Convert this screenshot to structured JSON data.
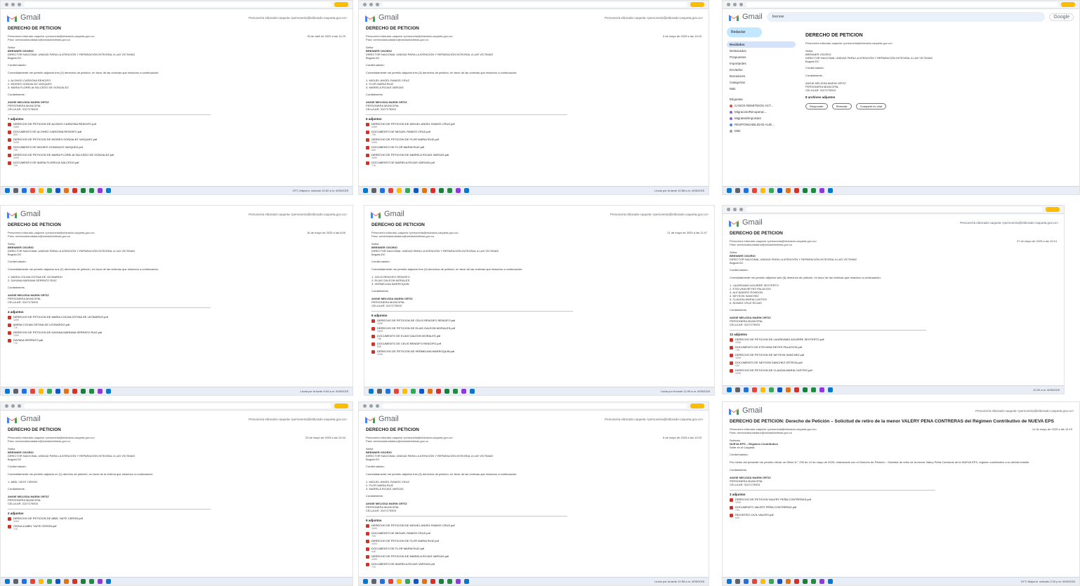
{
  "app": {
    "brand": "Gmail"
  },
  "account_line": "Personería eldorado-caqueta <personeria@eldorado-caqueta.gov.co>",
  "to_line": "Para: servicioalciudadano@unidadvictimas.gov.co",
  "closing": "Cordialmente,",
  "signer": [
    "ANGIE MELISSA MARIN ORTIZ",
    "PERSONERA MUNICIPAL",
    "CELULAR: 3107175903"
  ],
  "salutation": "Cordial saludo:",
  "recipient_block": [
    "Señor",
    "BRENNER OSORIO",
    "DIRECTOR NACIONAL UNIDAD PARA LA ATENCIÓN Y REPARACIÓN INTEGRAL A LAS VÍCTIMAS",
    "Bogotá DC"
  ],
  "tiles": [
    {
      "subject": "DERECHO DE PETICIÓN",
      "date": "30 de abril de 2025 a las 11:29",
      "intro": "Comedidamente me permito adjuntar tres (3) derechos de petición, en favor de las víctimas que relaciono a continuación:",
      "list": [
        "1. ALONSO CARDONA RENGIFO",
        "2. MOISES GONZALEZ VASQUEZ",
        "3. MARIA FLORELIA SALCEDO DE GONZALEZ"
      ],
      "attachments_title": "7 adjuntos",
      "attachments": [
        {
          "name": "DERECHO DE PETICION DE ALONSO CARDONA RENGIFO.pdf",
          "size": "348K"
        },
        {
          "name": "DOCUMENTO DE ALONSO CARDONA RENGIFO.pdf",
          "size": "83K"
        },
        {
          "name": "DERECHO DE PETICION DE MOISES GONZALEZ VASQUEZ.pdf",
          "size": "349K"
        },
        {
          "name": "DOCUMENTO DE MOISES GONZALEZ VASQUEZ.pdf",
          "size": "79K"
        },
        {
          "name": "DERECHO DE PETICION DE MARIA FLORELIA SALCEDO DE GONZALEZ.pdf",
          "size": "349K"
        },
        {
          "name": "DOCUMENTO DE MARIA FLORELIA SALCEDO.pdf",
          "size": "70K"
        }
      ],
      "taskbar_right": "19°C Mayorm. soleado  10:52 a.m. 6/05/2025"
    },
    {
      "subject": "DERECHO DE PETICIÓN",
      "date": "6 de mayo de 2025 a las 10:03",
      "intro": "Comedidamente me permito adjuntar tres (3) derechos de petición, en favor de las víctimas que relaciono a continuación:",
      "list": [
        "1. MIGUEL ANGEL RAMOS CRUZ",
        "2. FLOR MARIA RUIZ",
        "3. MARIELA ROJAS VARGAS"
      ],
      "attachments_title": "6 adjuntos",
      "attachments": [
        {
          "name": "DERECHO DE PETICION DE MIGUEL ANGEL RAMOS CRUZ.pdf",
          "size": "349K"
        },
        {
          "name": "DOCUMENTO DE MIGUEL RAMOS CRUZ.pdf",
          "size": "79K"
        },
        {
          "name": "DERECHO DE PETICION DE FLOR MARIA RUIZ.pdf",
          "size": "349K"
        },
        {
          "name": "DOCUMENTO DE FLOR MARIA RUIZ.pdf",
          "size": "64K"
        },
        {
          "name": "DERECHO DE PETICION DE MARIELA ROJAS VARGAS.pdf",
          "size": "349K"
        },
        {
          "name": "DOCUMENTO DE MARIELA ROJAS VARGAS.pdf",
          "size": "71K"
        }
      ],
      "taskbar_right": "Lluvia por la tarde  10:58 a.m. 6/05/2025"
    },
    {
      "subject": "DERECHO DE PETICIÓN",
      "search": "brenner",
      "sidebar": [
        {
          "label": "Recibidos",
          "count": "",
          "active": true
        },
        {
          "label": "Destacados",
          "count": ""
        },
        {
          "label": "Pospuestos",
          "count": ""
        },
        {
          "label": "Importantes",
          "count": ""
        },
        {
          "label": "Enviados",
          "count": ""
        },
        {
          "label": "Borradores",
          "count": ""
        },
        {
          "label": "Categorías",
          "count": ""
        },
        {
          "label": "Más",
          "count": ""
        }
      ],
      "labels_title": "Etiquetas",
      "labels": [
        {
          "name": "CASOS REMITIDOS ACT...",
          "color": "#e8453c"
        },
        {
          "name": "Migración/Recuperac...",
          "color": "#8e63ce"
        },
        {
          "name": "Migrated/Important",
          "color": "#8e63ce"
        },
        {
          "name": "RESPONSABILIDAD AUD...",
          "color": "#4a86e8"
        },
        {
          "name": "Más",
          "color": "#9aa0a6"
        }
      ],
      "attachments_title": "8 archivos adjuntos",
      "reply": [
        "Responder",
        "Reenviar",
        "Compartir en chat"
      ],
      "google": "Google"
    },
    {
      "subject": "DERECHO DE PETICIÓN",
      "date": "16 de mayo de 2025 a las 8:59",
      "intro": "Comedidamente me permito adjuntar dos (2) derechos de petición, en favor de las víctimas que relaciono a continuación:",
      "list": [
        "1. MARIA COLMA OSTINA DE LEONARDO",
        "2. DAYANA MARIANA SERRATO RUIZ"
      ],
      "attachments_title": "4 adjuntos",
      "attachments": [
        {
          "name": "DERECHO DE PETICION DE MARIA COLMA OSTINA DE LEONARDO.pdf",
          "size": "349K"
        },
        {
          "name": "MARIA COLMA OSTINA DE LEONARDO.pdf",
          "size": "71K"
        },
        {
          "name": "DERECHO DE PETICION DE DAYANA MARIANA SERRATO RUIZ.pdf",
          "size": "349K"
        },
        {
          "name": "DAYANA SERRATO.pdf",
          "size": "71K"
        }
      ],
      "taskbar_right": "Lluvia por la tarde  9:04 a.m. 6/05/2025"
    },
    {
      "subject": "DERECHO DE PETICIÓN",
      "date": "21 de mayo de 2025 a las 11:47",
      "intro": "Comedidamente me permito adjuntar tres (3) derechos de petición, en favor de las víctimas que relaciono a continuación:",
      "list": [
        "1. CELIS RENGIFO RENGIFO",
        "2. ELIAS GALEON MORALES",
        "3. HERMELINA MARROQUIN"
      ],
      "attachments_title": "6 adjuntos",
      "attachments": [
        {
          "name": "DERECHO DE PETICION DE CELIS RENGIFO RENGIFO.pdf",
          "size": "349K"
        },
        {
          "name": "DERECHO DE PETICION DE ELIAS GALEON MORALES.pdf",
          "size": "349K"
        },
        {
          "name": "DOCUMENTO DE ELIAS GALEON MORALES.pdf",
          "size": "79K"
        },
        {
          "name": "DOCUMENTO DE CELIS RENGIFO RENGIFO.pdf",
          "size": "83K"
        },
        {
          "name": "DERECHO DE PETICION DE HERMELINA MARROQUIN.pdf",
          "size": "349K"
        }
      ],
      "taskbar_right": "Lluvia por la tarde  11:59 a.m. 6/05/2025"
    },
    {
      "subject": "DERECHO DE PETICIÓN",
      "date": "27 de mayo de 2025 a las 10:14",
      "intro": "Comedidamente me permito adjuntar seis (6) derechos de petición, en favor de las víctimas que relaciono a continuación:",
      "list": [
        "1. LAURIDAMO AGUIRRE SEXTERTO",
        "2. ETELVINA REYES PALACIOS",
        "3. ALEJANDRO RONDON",
        "4. NEYSON SANCHEZ",
        "5. CLAUDIA MARIA CASTRO",
        "6. NOMAS CRUZ ROJAS"
      ],
      "attachments_title": "12 adjuntos",
      "attachments": [
        {
          "name": "DERECHO DE PETICION DE LAURIDAMO AGUIRRE SEXTERTO.pdf",
          "size": "349K"
        },
        {
          "name": "DOCUMENTO DE ETELVINA REYES PALACIOS.pdf",
          "size": "71K"
        },
        {
          "name": "DERECHO DE PETICION DE NEYSON SANCHEZ.pdf",
          "size": "349K"
        },
        {
          "name": "DOCUMENTO DE NEYSON SANCHEZ ORTEGA.pdf",
          "size": "64K"
        },
        {
          "name": "DERECHO DE PETICION DE CLAUDIA MARIA CASTRO.pdf",
          "size": "349K"
        }
      ],
      "taskbar_right": "  10:20 a.m. 6/05/2025"
    },
    {
      "subject": "DERECHO DE PETICIÓN",
      "date": "23 de mayo de 2025 a las 10:43",
      "intro": "Comedidamente me permito adjuntar un (1) derecho de petición, en favor de la víctima que relaciono a continuación:",
      "list": [
        "1. ABEL YAITE CERON"
      ],
      "attachments_title": "2 adjuntos",
      "attachments": [
        {
          "name": "DERECHO DE PETICION DE ABEL YAITE CERON.pdf",
          "size": "349K"
        },
        {
          "name": "CEDULA ABEL YAITE CERON.pdf",
          "size": "71K"
        }
      ],
      "taskbar_right": ""
    },
    {
      "subject": "DERECHO DE PETICIÓN",
      "date": "6 de mayo de 2025 a las 10:03",
      "intro": "Comedidamente me permito adjuntar tres (3) derechos de petición, en favor de las víctimas que relaciono a continuación:",
      "list": [
        "1. MIGUEL ANGEL RAMOS CRUZ",
        "2. FLOR MARIA RUIZ",
        "3. MARIELA ROJAS VARGAS"
      ],
      "attachments_title": "6 adjuntos",
      "attachments": [
        {
          "name": "DERECHO DE PETICION DE MIGUEL ANGEL RAMOS CRUZ.pdf",
          "size": "349K"
        },
        {
          "name": "DOCUMENTO DE MIGUEL RAMOS CRUZ.pdf",
          "size": "79K"
        },
        {
          "name": "DERECHO DE PETICION DE FLOR MARIA RUIZ.pdf",
          "size": "349K"
        },
        {
          "name": "DOCUMENTO DE FLOR MARIA RUIZ.pdf",
          "size": "64K"
        },
        {
          "name": "DERECHO DE PETICION DE MARIELA ROJAS VARGAS.pdf",
          "size": "349K"
        },
        {
          "name": "DOCUMENTO DE MARIELA ROJAS VARGAS.pdf",
          "size": "71K"
        }
      ],
      "taskbar_right": "Lluvia por la tarde  10:58 a.m. 6/05/2025"
    },
    {
      "subject": "DERECHO DE PETICION: Derecho de Petición – Solicitud de retiro de la menor VALERY PEÑA CONTRERAS del Régimen Contributivo de NUEVA EPS",
      "date": "14 de mayo de 2025 a las 14:19",
      "intro": "Por medio del presente me permito elevar un Oficio N.° 235 de 14 de mayo de 2025, relacionado con el Derecho de Petición – Solicitud de retiro de la menor Valery Peña Contreras de la NUEVA EPS, régimen contributivo a su debido trámite.",
      "recipient": [
        "Señores",
        "NUEVA EPS – Régimen Contributivo",
        "Sede en el Caquetá"
      ],
      "list": [],
      "attachments_title": "3 adjuntos",
      "attachments": [
        {
          "name": "DERECHO DE PETICION VALERY PEÑA CONTRERAS.pdf",
          "size": "349K"
        },
        {
          "name": "DOCUMENTO VALERY PEÑA CONTRERAS.pdf",
          "size": "71K"
        },
        {
          "name": "REGISTRO CIVIL VALERY.pdf",
          "size": "64K"
        }
      ],
      "taskbar_right": "19°C Mayorm. soleado  2:20 p.m. 6/05/2025"
    }
  ]
}
